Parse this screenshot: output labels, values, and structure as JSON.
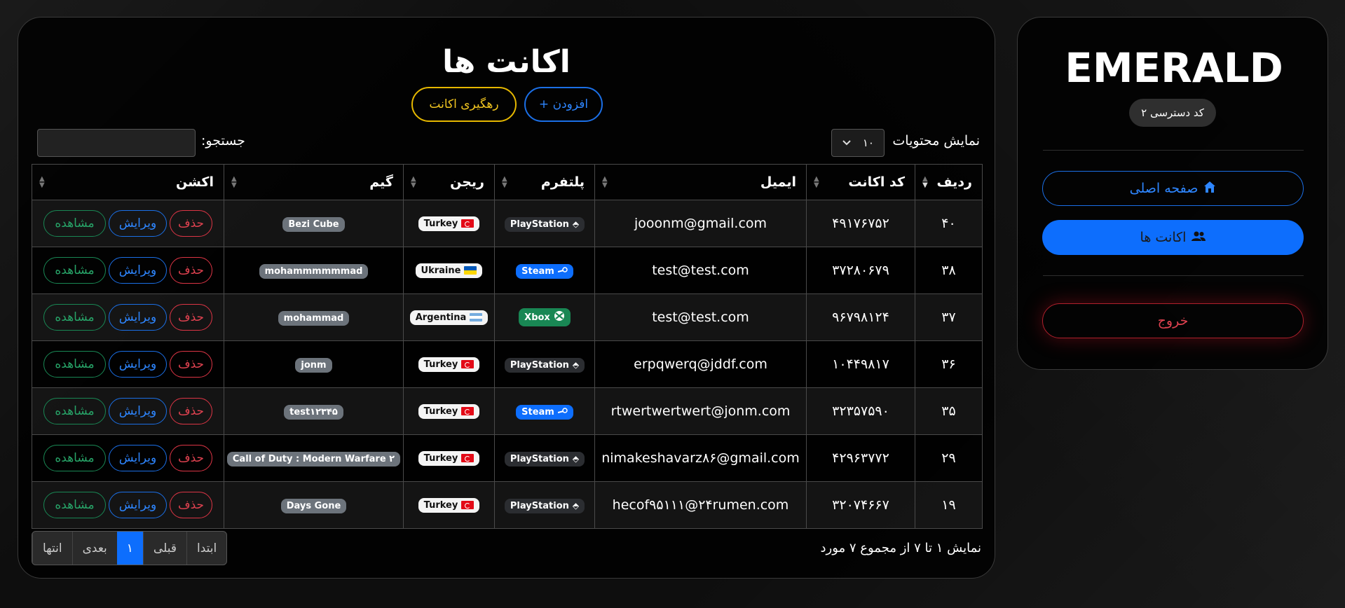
{
  "colors": {
    "primary": "#0d6efd",
    "warning": "#f0c420",
    "danger": "#dc3545",
    "success": "#198754"
  },
  "sidebar": {
    "logo": "EMERALD",
    "access_level": "کد دسترسی ۲",
    "home_label": "صفحه اصلی",
    "home_icon": "home-icon",
    "accounts_label": "اکانت ها",
    "accounts_icon": "users-icon",
    "logout_label": "خروج"
  },
  "main": {
    "title": "اکانت ها",
    "add_button": "+ افزودن",
    "track_button": "رهگیری اکانت",
    "entries_label": "نمایش محتویات",
    "entries_value": "۱۰",
    "search_label": "جستجو:",
    "columns": [
      "ردیف",
      "کد اکانت",
      "ایمیل",
      "پلتفرم",
      "ریجن",
      "گیم",
      "اکشن"
    ],
    "rows": [
      {
        "row": "۴۰",
        "code": "۴۹۱۷۶۷۵۲",
        "email": "jooonm@gmail.com",
        "platform": "PlayStation",
        "region": "Turkey",
        "game": "Bezi Cube"
      },
      {
        "row": "۳۸",
        "code": "۳۷۲۸۰۶۷۹",
        "email": "test@test.com",
        "platform": "Steam",
        "region": "Ukraine",
        "game": "mohammmmmmad"
      },
      {
        "row": "۳۷",
        "code": "۹۶۷۹۸۱۲۴",
        "email": "test@test.com",
        "platform": "Xbox",
        "region": "Argentina",
        "game": "mohammad"
      },
      {
        "row": "۳۶",
        "code": "۱۰۴۴۹۸۱۷",
        "email": "erpqwerq@jddf.com",
        "platform": "PlayStation",
        "region": "Turkey",
        "game": "jonm"
      },
      {
        "row": "۳۵",
        "code": "۳۲۳۵۷۵۹۰",
        "email": "rtwertwertwert@jonm.com",
        "platform": "Steam",
        "region": "Turkey",
        "game": "test۱۲۳۴۵"
      },
      {
        "row": "۲۹",
        "code": "۴۲۹۶۳۷۷۲",
        "email": "nimakeshavarz۸۶@gmail.com",
        "platform": "PlayStation",
        "region": "Turkey",
        "game": "Call of Duty : Modern Warfare ۲"
      },
      {
        "row": "۱۹",
        "code": "۳۲۰۷۴۶۶۷",
        "email": "hecof۹۵۱۱۱@۲۴rumen.com",
        "platform": "PlayStation",
        "region": "Turkey",
        "game": "Days Gone"
      }
    ],
    "actions": {
      "delete": "حذف",
      "edit": "ویرایش",
      "view": "مشاهده"
    },
    "info": "نمایش ۱ تا ۷ از مجموع ۷ مورد",
    "pager": {
      "first": "ابتدا",
      "prev": "قبلی",
      "current": "۱",
      "next": "بعدی",
      "last": "انتها"
    }
  }
}
